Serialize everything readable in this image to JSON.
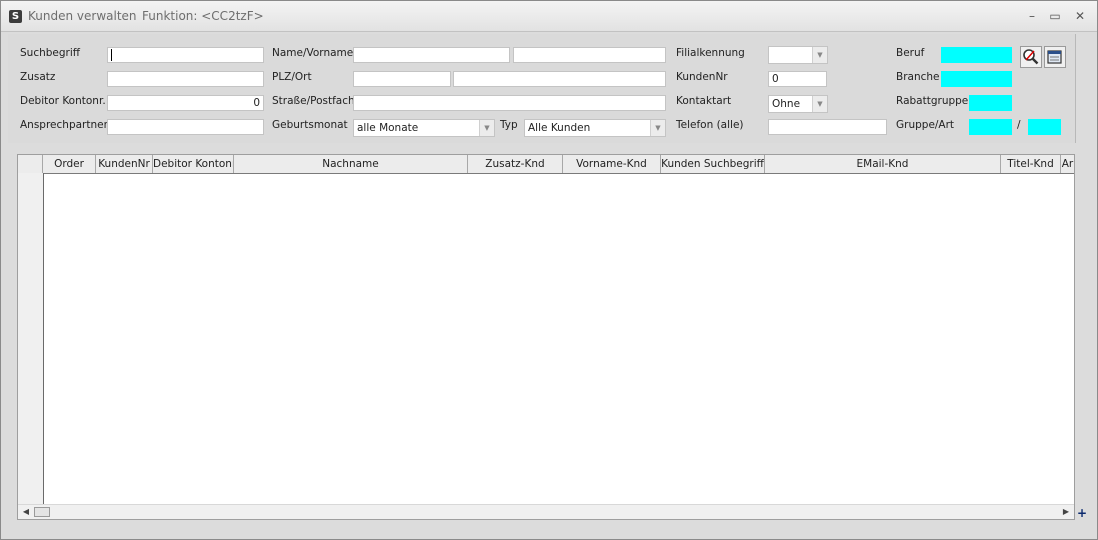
{
  "window": {
    "title": "Kunden verwalten",
    "function_label": "Funktion: <CC2tzF>",
    "controls": {
      "minimize": "–",
      "maximize": "▭",
      "close": "✕"
    }
  },
  "form": {
    "suchbegriff": {
      "label": "Suchbegriff",
      "value": ""
    },
    "zusatz": {
      "label": "Zusatz",
      "value": ""
    },
    "debitor": {
      "label": "Debitor Kontonr.",
      "value": "0"
    },
    "ansprechpartner": {
      "label": "Ansprechpartner",
      "value": ""
    },
    "name_vorname": {
      "label": "Name/Vorname",
      "name_value": "",
      "vorname_value": ""
    },
    "plz_ort": {
      "label": "PLZ/Ort",
      "plz_value": "",
      "ort_value": ""
    },
    "strasse": {
      "label": "Straße/Postfach",
      "value": ""
    },
    "geburtsmonat": {
      "label": "Geburtsmonat",
      "value": "alle Monate"
    },
    "typ": {
      "label": "Typ",
      "value": "Alle Kunden"
    },
    "filialkennung": {
      "label": "Filialkennung",
      "value": ""
    },
    "kundennr": {
      "label": "KundenNr",
      "value": "0"
    },
    "kontaktart": {
      "label": "Kontaktart",
      "value": "Ohne"
    },
    "telefon": {
      "label": "Telefon (alle)",
      "value": ""
    },
    "beruf": {
      "label": "Beruf"
    },
    "branche": {
      "label": "Branche"
    },
    "rabattgruppe": {
      "label": "Rabattgruppe"
    },
    "gruppe_art": {
      "label": "Gruppe/Art",
      "separator": "/"
    },
    "highlight_color": "#00ffff"
  },
  "toolbar": {
    "search_icon": "magnifier-icon",
    "clear_icon": "clear-form-icon"
  },
  "grid": {
    "columns": [
      "Order",
      "KundenNr",
      "Debitor Kontonr.",
      "Nachname",
      "Zusatz-Knd",
      "Vorname-Knd",
      "Kunden Suchbegriff",
      "EMail-Knd",
      "Titel-Knd",
      "Ar"
    ],
    "rows": []
  }
}
